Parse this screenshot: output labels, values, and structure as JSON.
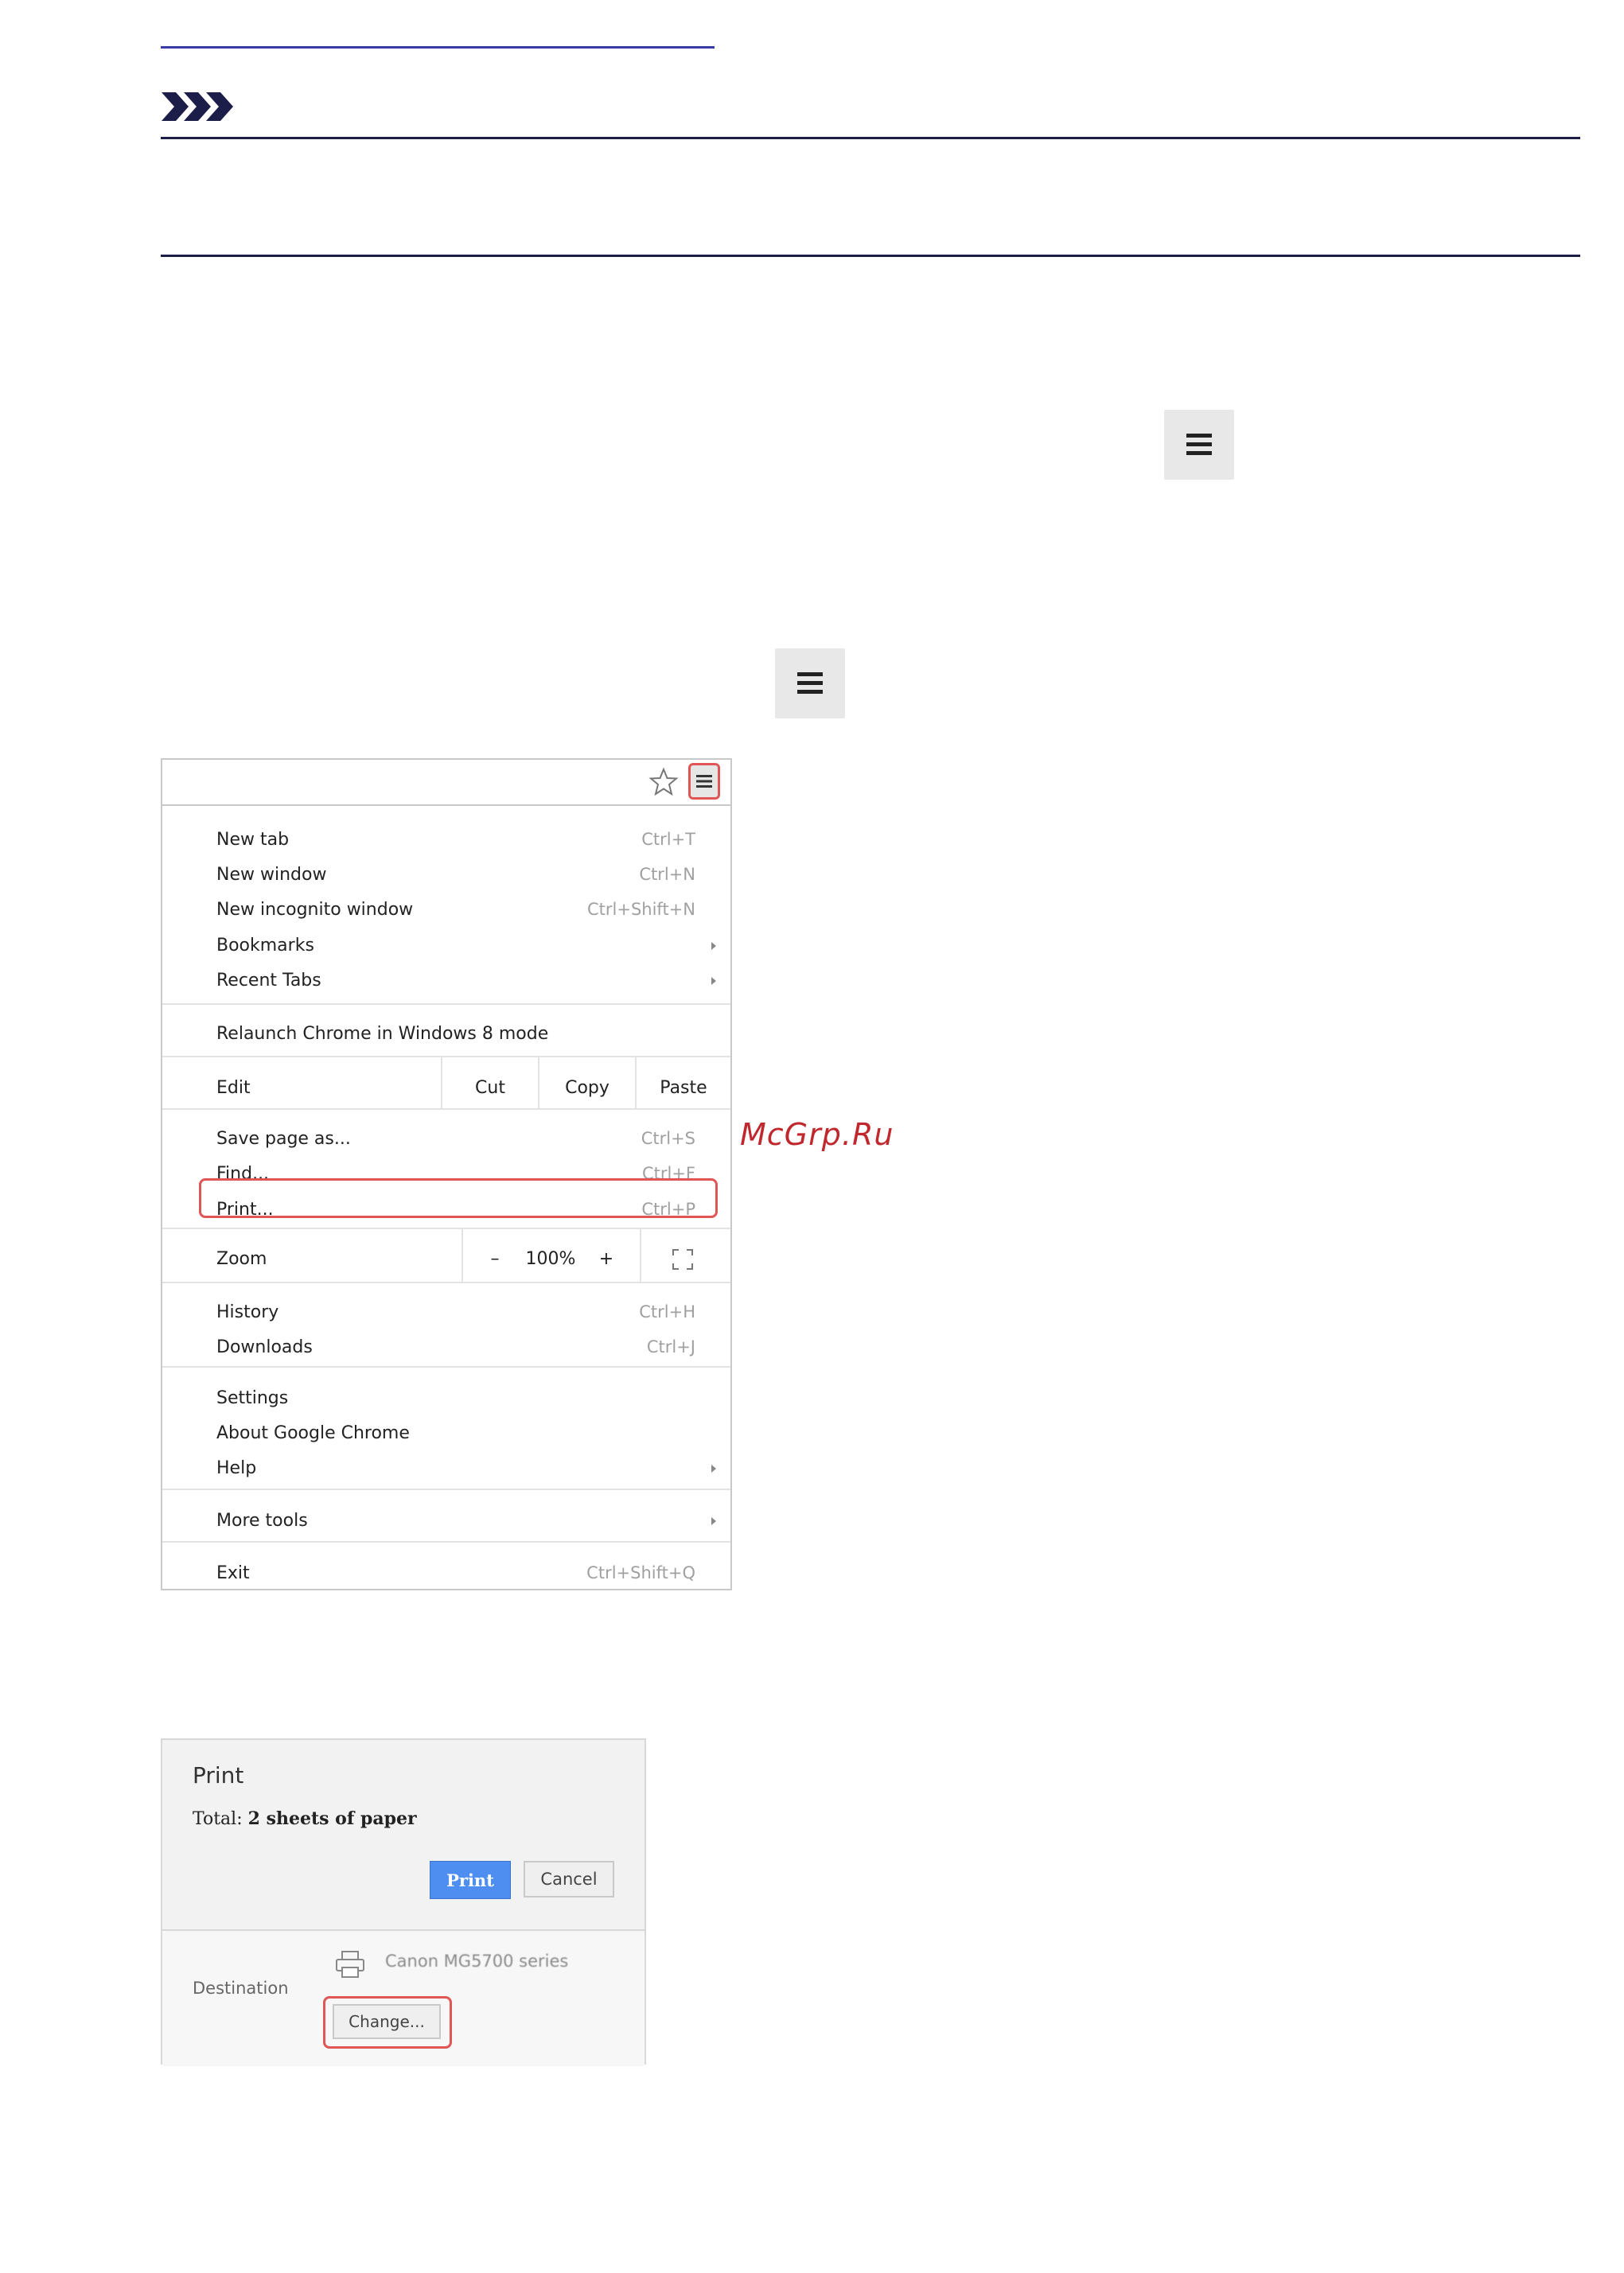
{
  "watermark": "McGrp.Ru",
  "chrome_menu": {
    "items": {
      "new_tab": {
        "label": "New tab",
        "shortcut": "Ctrl+T"
      },
      "new_window": {
        "label": "New window",
        "shortcut": "Ctrl+N"
      },
      "new_incognito": {
        "label": "New incognito window",
        "shortcut": "Ctrl+Shift+N"
      },
      "bookmarks": {
        "label": "Bookmarks"
      },
      "recent_tabs": {
        "label": "Recent Tabs"
      },
      "relaunch": {
        "label": "Relaunch Chrome in Windows 8 mode"
      },
      "save_page": {
        "label": "Save page as...",
        "shortcut": "Ctrl+S"
      },
      "find": {
        "label": "Find...",
        "shortcut": "Ctrl+F"
      },
      "print": {
        "label": "Print...",
        "shortcut": "Ctrl+P"
      },
      "history": {
        "label": "History",
        "shortcut": "Ctrl+H"
      },
      "downloads": {
        "label": "Downloads",
        "shortcut": "Ctrl+J"
      },
      "settings": {
        "label": "Settings"
      },
      "about": {
        "label": "About Google Chrome"
      },
      "help": {
        "label": "Help"
      },
      "more_tools": {
        "label": "More tools"
      },
      "exit": {
        "label": "Exit",
        "shortcut": "Ctrl+Shift+Q"
      }
    },
    "edit": {
      "label": "Edit",
      "cut": "Cut",
      "copy": "Copy",
      "paste": "Paste"
    },
    "zoom": {
      "label": "Zoom",
      "minus": "–",
      "level": "100%",
      "plus": "+"
    }
  },
  "print_dialog": {
    "title": "Print",
    "total_prefix": "Total: ",
    "total_value": "2 sheets of paper",
    "print_button": "Print",
    "cancel_button": "Cancel",
    "destination_label": "Destination",
    "printer_name": "Canon MG5700 series",
    "change_button": "Change..."
  },
  "colors": {
    "highlight": "#e05555",
    "print_button_bg": "#4d8ef0",
    "watermark": "#c0282d",
    "link": "#3a3aa8"
  }
}
